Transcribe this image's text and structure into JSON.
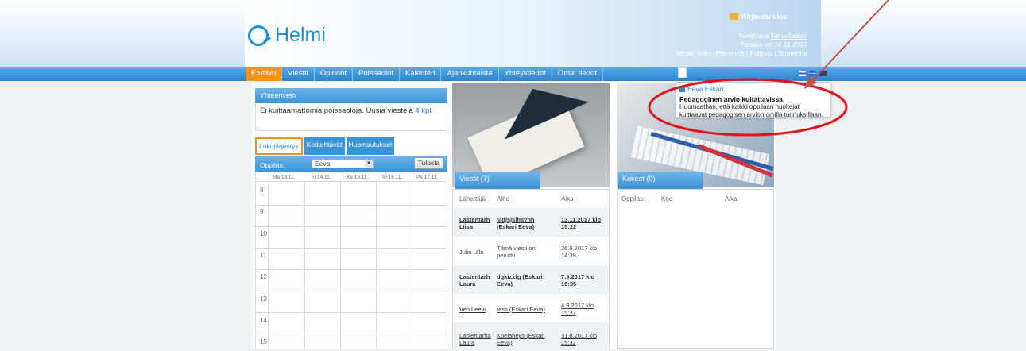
{
  "app": {
    "name": "Helmi"
  },
  "header": {
    "logout": "Kirjaudu ulos",
    "welcome_prefix": "Tervetuloa",
    "user_name": "Taina Eskari",
    "date_line": "Tänään on 14.11.2017",
    "text_size_label": "Tekstin koko:",
    "text_size_smaller": "Pienennä",
    "text_size_reset": "Palauta",
    "text_size_larger": "Suurenna"
  },
  "nav": [
    "Etusivu",
    "Viestit",
    "Opinnot",
    "Poissaolot",
    "Kalenteri",
    "Ajankohtaista",
    "Yhteystiedot",
    "Omat tiedot"
  ],
  "summary": {
    "title": "Yhteenveto",
    "text": "Ei kuittaamattomia poissaoloja. Uusia viestejä",
    "link": "4 kpl."
  },
  "schedule": {
    "tabs": [
      "Lukujärjestys",
      "Kotitehtävät",
      "Huomautukset"
    ],
    "student_label": "Oppilas:",
    "student_value": "Eeva",
    "print": "Tulosta",
    "days": [
      "Ma 13.11.",
      "Ti 14.11.",
      "Ke 15.11.",
      "To 16.11.",
      "Pe 17.11."
    ],
    "hours": [
      "8",
      "9",
      "10",
      "11",
      "12",
      "13",
      "14",
      "15"
    ]
  },
  "messages": {
    "title": "Viestit (7)",
    "col_sender": "Lähettäjä",
    "col_subject": "Aihe",
    "col_time": "Aika",
    "rows": [
      {
        "sender": "Lastentarh Liisa",
        "subject": "sidjsjslhsvhh (Eskari Eeva)",
        "time": "13.11.2017 klo 15:22"
      },
      {
        "sender": "Julin Ulla",
        "subject": "Tämä viesti on peruttu",
        "time": "26.9.2017 klo 14:39"
      },
      {
        "sender": "Lastentarh Laura",
        "subject": "dgkizxfg (Eskari Eeva)",
        "time": "7.9.2017 klo 15:35"
      },
      {
        "sender": "Veo Leevi",
        "subject": "testi (Eskari Eeva)",
        "time": "4.9.2017 klo 15:37"
      },
      {
        "sender": "Lastentarha Laura",
        "subject": "Koeläheys (Eskari Eeva)",
        "time": "31.8.2017 klo 15:32"
      }
    ]
  },
  "exams": {
    "title": "Kokeet (0)",
    "col_student": "Oppilas:",
    "col_exam": "Koe",
    "col_time": "Aika"
  },
  "tooltip": {
    "name": "Eeva Eskari",
    "title": "Pedagoginen arvio kuitattavissa",
    "body": "Huomaathan, että kaikki oppilaan huoltajat kuittaavat pedagogisen arvion omilla tunnuksillaan."
  },
  "colors": {
    "brand": "#1e8fd4",
    "nav_active": "#f3931c",
    "annotation": "#e3131b"
  }
}
